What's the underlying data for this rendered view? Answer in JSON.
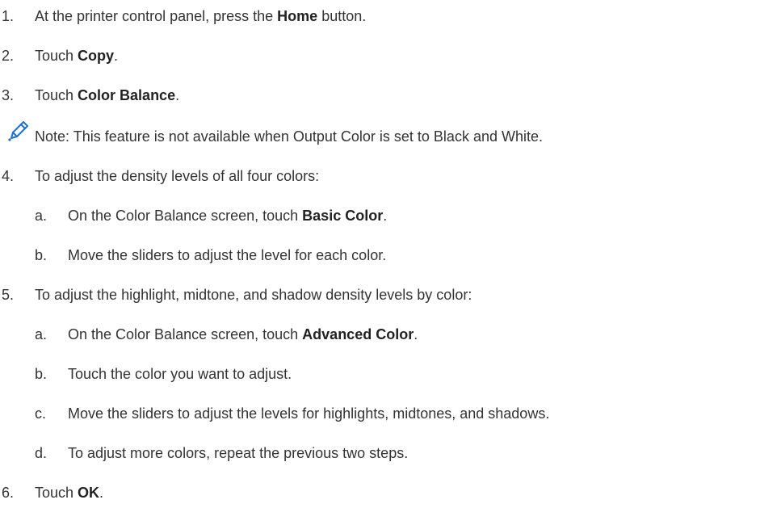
{
  "steps": [
    {
      "num": "1.",
      "pre": "At the printer control panel, press the ",
      "bold": "Home",
      "post": " button."
    },
    {
      "num": "2.",
      "pre": "Touch ",
      "bold": "Copy",
      "post": "."
    },
    {
      "num": "3.",
      "pre": "Touch ",
      "bold": "Color Balance",
      "post": "."
    },
    {
      "num": "4.",
      "text": "To adjust the density levels of all four colors:"
    },
    {
      "num": "5.",
      "text": "To adjust the highlight, midtone, and shadow density levels by color:"
    },
    {
      "num": "6.",
      "pre": "Touch ",
      "bold": "OK",
      "post": "."
    }
  ],
  "note": {
    "icon": "pencil-icon",
    "text": "Note: This feature is not available when Output Color is set to Black and White."
  },
  "step4_sub": [
    {
      "letter": "a.",
      "pre": "On the Color Balance screen, touch ",
      "bold": "Basic Color",
      "post": "."
    },
    {
      "letter": "b.",
      "text": "Move the sliders to adjust the level for each color."
    }
  ],
  "step5_sub": [
    {
      "letter": "a.",
      "pre": "On the Color Balance screen, touch ",
      "bold": "Advanced Color",
      "post": "."
    },
    {
      "letter": "b.",
      "text": "Touch the color you want to adjust."
    },
    {
      "letter": "c.",
      "text": "Move the sliders to adjust the levels for highlights, midtones, and shadows."
    },
    {
      "letter": "d.",
      "text": "To adjust more colors, repeat the previous two steps."
    }
  ],
  "colors": {
    "text": "#333333",
    "icon": "#1e6fd9"
  }
}
